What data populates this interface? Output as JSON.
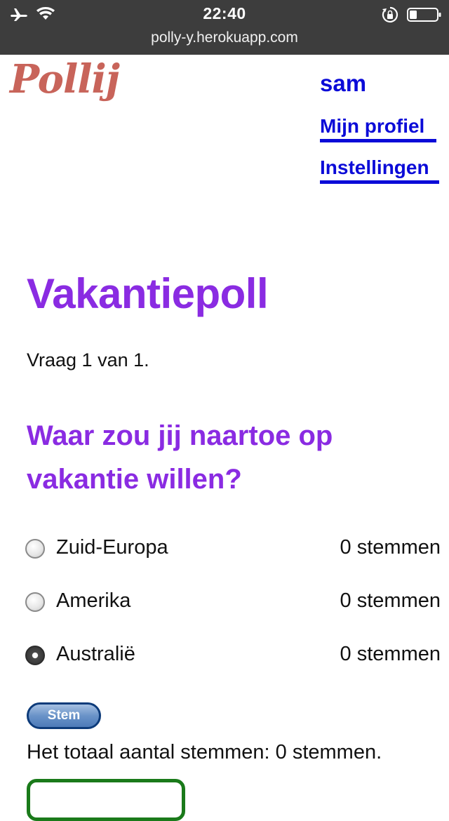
{
  "status_bar": {
    "time": "22:40",
    "url": "polly-y.herokuapp.com",
    "icons": [
      "airplane-icon",
      "wifi-icon",
      "lock-rotation-icon",
      "battery-icon"
    ]
  },
  "header": {
    "logo": "Pollij",
    "user": "sam",
    "nav": {
      "profile": "Mijn profiel",
      "settings": "Instellingen"
    }
  },
  "poll": {
    "title": "Vakantiepoll",
    "question_count": "Vraag 1 van 1.",
    "question": "Waar zou jij naartoe op vakantie willen?",
    "options": [
      {
        "label": "Zuid-Europa",
        "votes": "0 stemmen",
        "selected": false
      },
      {
        "label": "Amerika",
        "votes": "0 stemmen",
        "selected": false
      },
      {
        "label": "Australië",
        "votes": "0 stemmen",
        "selected": true
      }
    ],
    "vote_button": "Stem",
    "total": "Het totaal aantal stemmen: 0 stemmen."
  },
  "colors": {
    "accent_purple": "#8a2be2",
    "link_blue": "#0b0bd8",
    "logo": "#c8645a",
    "status_bar": "#3d3d3d"
  }
}
